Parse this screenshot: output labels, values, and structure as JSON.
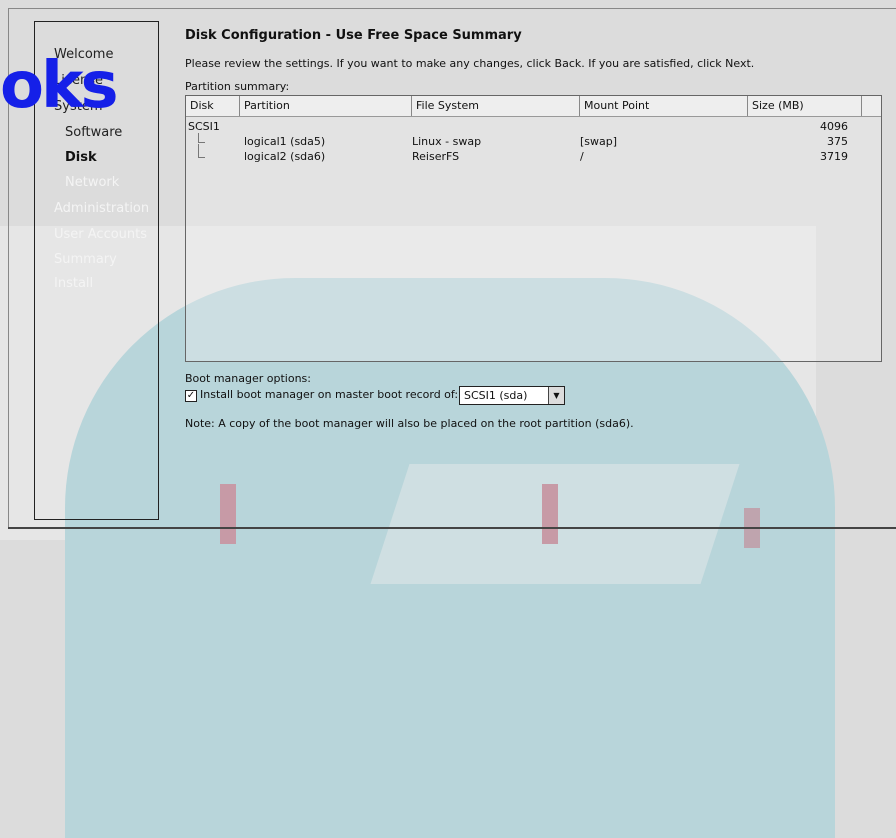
{
  "logo_text": "oks",
  "sidebar": {
    "items": [
      {
        "label": "Welcome",
        "state": "done"
      },
      {
        "label": "License",
        "state": "done"
      },
      {
        "label": "System",
        "state": "done"
      },
      {
        "label": "Software",
        "state": "sub"
      },
      {
        "label": "Disk",
        "state": "current"
      },
      {
        "label": "Network",
        "state": "pending"
      },
      {
        "label": "Administration",
        "state": "pending"
      },
      {
        "label": "User Accounts",
        "state": "pending"
      },
      {
        "label": "Summary",
        "state": "pending"
      },
      {
        "label": "Install",
        "state": "pending"
      }
    ]
  },
  "main": {
    "title": "Disk Configuration - Use Free Space Summary",
    "intro": "Please review the settings. If you want to make any changes, click Back. If you are satisfied, click Next.",
    "partition_summary_label": "Partition summary:",
    "table": {
      "columns": [
        "Disk",
        "Partition",
        "File System",
        "Mount Point",
        "Size (MB)"
      ],
      "rows": [
        {
          "disk": "SCSI1",
          "partition": "",
          "filesystem": "",
          "mount": "",
          "size": "4096"
        },
        {
          "disk": "",
          "partition": "logical1 (sda5)",
          "filesystem": "Linux - swap",
          "mount": "[swap]",
          "size": "375"
        },
        {
          "disk": "",
          "partition": "logical2 (sda6)",
          "filesystem": "ReiserFS",
          "mount": "/",
          "size": "3719"
        }
      ]
    },
    "boot": {
      "label": "Boot manager options:",
      "checkbox_label": "Install boot manager on master boot record of:",
      "checked": true,
      "select_value": "SCSI1 (sda)",
      "note": "Note: A copy of the boot manager will also be placed on the root partition (sda6)."
    }
  }
}
